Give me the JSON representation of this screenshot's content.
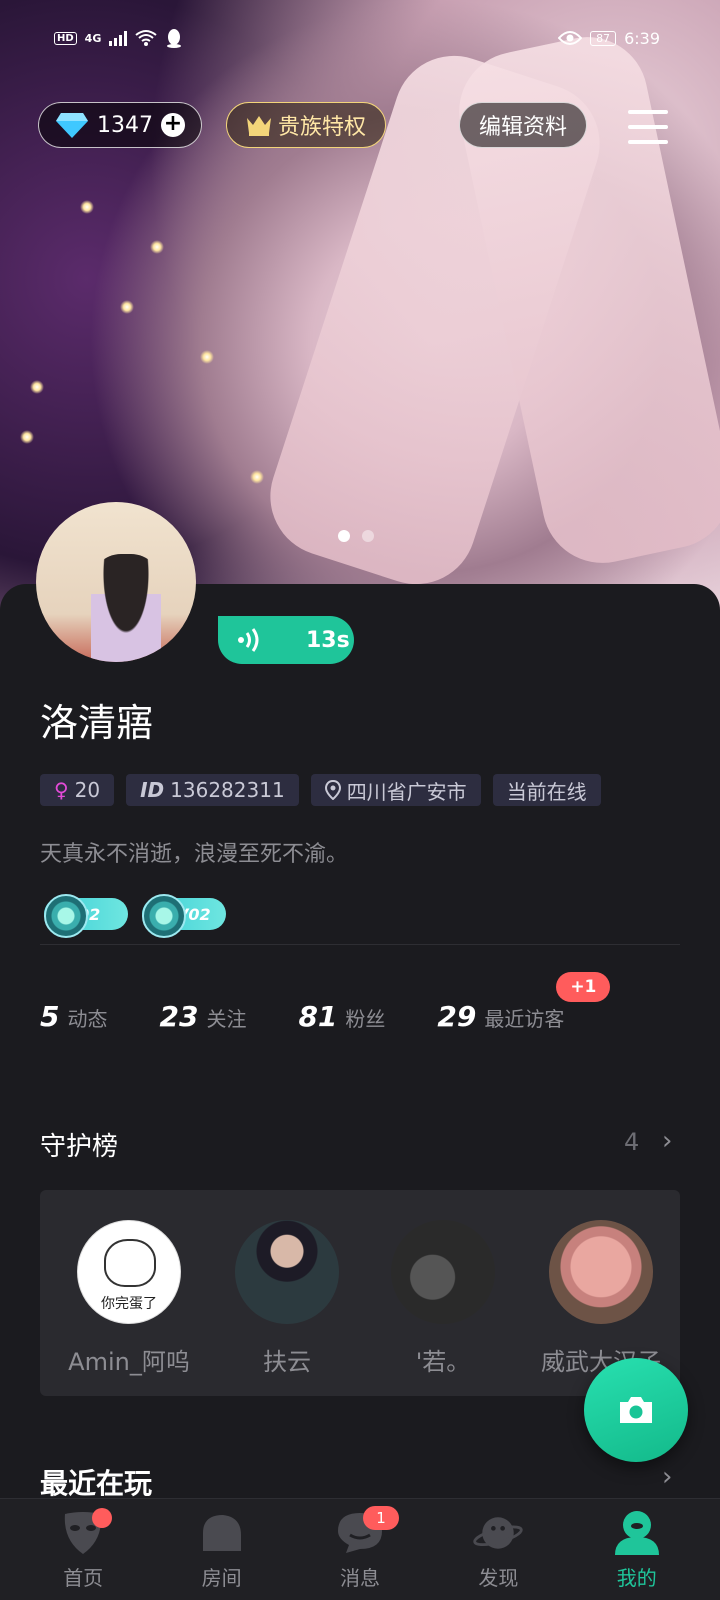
{
  "status_bar": {
    "network": "4G",
    "hd": "HD",
    "battery": "87",
    "time": "6:39"
  },
  "top_bar": {
    "diamond_count": "1347",
    "noble_label": "贵族特权",
    "edit_label": "编辑资料"
  },
  "profile": {
    "voice_duration": "13s",
    "name": "洛清寤",
    "age": "20",
    "id_label": "ID",
    "id": "136282311",
    "location": "四川省广安市",
    "online_status": "当前在线",
    "bio": "天真永不消逝，浪漫至死不渝。",
    "badges": [
      {
        "label": "02"
      },
      {
        "label": "V02"
      }
    ]
  },
  "stats": [
    {
      "num": "5",
      "label": "动态"
    },
    {
      "num": "23",
      "label": "关注"
    },
    {
      "num": "81",
      "label": "粉丝"
    },
    {
      "num": "29",
      "label": "最近访客",
      "badge": "+1"
    }
  ],
  "guardians": {
    "title": "守护榜",
    "count": "4",
    "members": [
      {
        "name": "Amin_阿呜",
        "avatar_caption": "你完蛋了"
      },
      {
        "name": "扶云"
      },
      {
        "name": "'若。"
      },
      {
        "name": "威武大汉子"
      }
    ]
  },
  "recent": {
    "title": "最近在玩"
  },
  "bottom_nav": {
    "items": [
      {
        "label": "首页",
        "icon": "mask-icon"
      },
      {
        "label": "房间",
        "icon": "room-icon"
      },
      {
        "label": "消息",
        "icon": "message-icon",
        "badge": "1"
      },
      {
        "label": "发现",
        "icon": "planet-icon"
      },
      {
        "label": "我的",
        "icon": "me-icon"
      }
    ],
    "active": "我的"
  },
  "colors": {
    "accent": "#1fc59a",
    "badge_red": "#ff5c5c",
    "background": "#1b1b1f",
    "noble_gold": "#f3d57a"
  }
}
